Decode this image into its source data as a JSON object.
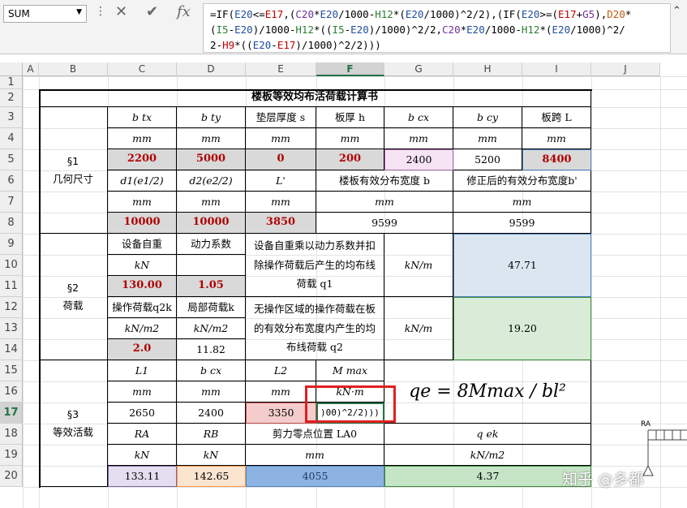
{
  "namebox": "SUM",
  "fx": "fx",
  "formula_parts": [
    [
      "=IF(",
      ""
    ],
    [
      "E20",
      "fb"
    ],
    [
      "<=",
      ""
    ],
    [
      "E17",
      "fr"
    ],
    [
      ",(",
      ""
    ],
    [
      "C20",
      "fp"
    ],
    [
      "*",
      ""
    ],
    [
      "E20",
      "fb"
    ],
    [
      "/1000-",
      ""
    ],
    [
      "H12",
      "fg"
    ],
    [
      "*(",
      ""
    ],
    [
      "E20",
      "fb"
    ],
    [
      "/1000)^2/2),(IF(",
      ""
    ],
    [
      "E20",
      "fb"
    ],
    [
      ">=(",
      ""
    ],
    [
      "E17",
      "fr"
    ],
    [
      "+",
      ""
    ],
    [
      "G5",
      "fp"
    ],
    [
      "),",
      ""
    ],
    [
      "D20",
      "fo"
    ],
    [
      "*\n(",
      ""
    ],
    [
      "I5",
      "fg"
    ],
    [
      "-",
      ""
    ],
    [
      "E20",
      "fb"
    ],
    [
      ")/1000-",
      ""
    ],
    [
      "H12",
      "fg"
    ],
    [
      "*((",
      ""
    ],
    [
      "I5",
      "fg"
    ],
    [
      "-",
      ""
    ],
    [
      "E20",
      "fb"
    ],
    [
      ")/1000)^2/2,",
      ""
    ],
    [
      "C20",
      "fp"
    ],
    [
      "*",
      ""
    ],
    [
      "E20",
      "fb"
    ],
    [
      "/1000-",
      ""
    ],
    [
      "H12",
      "fg"
    ],
    [
      "*(",
      ""
    ],
    [
      "E20",
      "fb"
    ],
    [
      "/1000)^2/\n2-",
      ""
    ],
    [
      "H9",
      "fr"
    ],
    [
      "*((",
      ""
    ],
    [
      "E20",
      "fb"
    ],
    [
      "-",
      ""
    ],
    [
      "E17",
      "fr"
    ],
    [
      ")/1000)^2/2)))",
      ""
    ]
  ],
  "columns": [
    "A",
    "B",
    "C",
    "D",
    "E",
    "F",
    "G",
    "H",
    "I",
    "J"
  ],
  "rows": [
    "1",
    "2",
    "3",
    "4",
    "5",
    "6",
    "7",
    "8",
    "9",
    "10",
    "11",
    "12",
    "13",
    "14",
    "15",
    "16",
    "17",
    "18",
    "19",
    "20"
  ],
  "title": "楼板等效均布活荷载计算书",
  "s1": {
    "label": "§1\n几何尺寸",
    "b_tx": "b tx",
    "b_ty": "b ty",
    "layer": "垫层厚度 s",
    "h": "板厚 h",
    "b_cx": "b cx",
    "b_cy": "b cy",
    "L": "板跨 L",
    "mm": "mm",
    "v_btx": "2200",
    "v_bty": "5000",
    "v_s": "0",
    "v_h": "200",
    "v_bcx": "2400",
    "v_bcy": "5200",
    "v_L": "8400",
    "d1": "d1(e1/2)",
    "d2": "d2(e2/2)",
    "Lp": "L'",
    "b_eff": "楼板有效分布宽度 b",
    "b_eff2": "修正后的有效分布宽度b'",
    "v_d1": "10000",
    "v_d2": "10000",
    "v_Lp": "3850",
    "v_b": "9599",
    "v_b2": "9599"
  },
  "s2": {
    "label": "§2\n荷载",
    "dev_w": "设备自重",
    "dyn": "动力系数",
    "kN": "kN",
    "v_w": "130.00",
    "v_dyn": "1.05",
    "desc1": "设备自重乘以动力系数并扣除操作荷载后产生的均布线荷载 q1",
    "unit": "kN/m",
    "q1": "47.71",
    "op": "操作荷载q2k",
    "local": "局部荷载k",
    "kNm2": "kN/m2",
    "v_op": "2.0",
    "v_local": "11.82",
    "desc2": "无操作区域的操作荷载在板的有效分布宽度内产生的均布线荷载 q2",
    "q2": "19.20"
  },
  "s3": {
    "label": "§3\n等效活载",
    "L1": "L1",
    "bcx": "b cx",
    "L2": "L2",
    "Mmax": "M max",
    "mm": "mm",
    "kNm": "kN·m",
    "v_L1": "2650",
    "v_bcx": "2400",
    "v_L2": "3350",
    "v_edit": ")00)^2/2)))",
    "RA": "RA",
    "RB": "RB",
    "shear": "剪力零点位置 LA0",
    "qek": "q ek",
    "kN": "kN",
    "kNm2": "kN/m2",
    "v_RA": "133.11",
    "v_RB": "142.65",
    "v_LA0": "4055",
    "v_qek": "4.37",
    "formula": "qe = 8Mmax / bl²"
  },
  "watermark": "知乎 @多都"
}
